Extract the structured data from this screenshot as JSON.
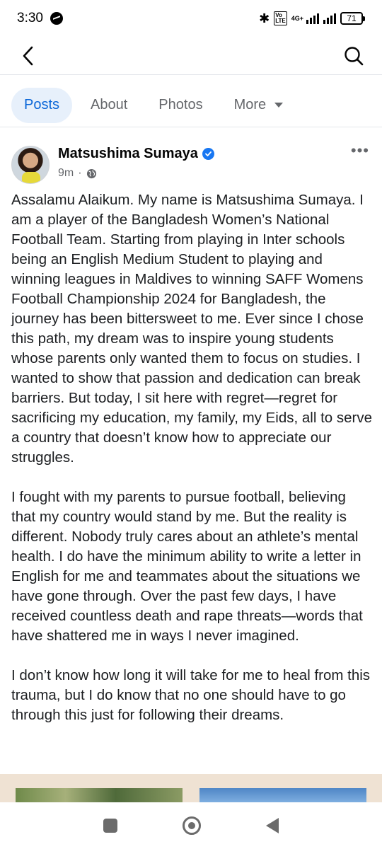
{
  "status_bar": {
    "time": "3:30",
    "network": "4G+",
    "battery": "71"
  },
  "top_bar": {
    "back_icon": "chevron-left-icon",
    "search_icon": "search-icon"
  },
  "tabs": [
    {
      "label": "Posts",
      "active": true
    },
    {
      "label": "About",
      "active": false
    },
    {
      "label": "Photos",
      "active": false
    },
    {
      "label": "More",
      "active": false
    }
  ],
  "post": {
    "author": "Matsushima Sumaya",
    "time": "9m",
    "separator": "·",
    "paragraphs": [
      "Assalamu Alaikum. My name is Matsushima Sumaya. I am a player of the Bangladesh Women’s National Football Team. Starting from playing in Inter schools being an English Medium Student to playing and winning leagues in Maldives to winning SAFF Womens Football Championship 2024 for Bangladesh, the journey has been bittersweet to me. Ever since I chose this path, my dream was to inspire young students whose parents only wanted them to focus on studies. I wanted to show that passion and dedication can break barriers. But today, I sit here with regret—regret for sacrificing my education, my family, my Eids, all to serve a country that doesn’t know how to appreciate our struggles.",
      "I fought with my parents to pursue football, believing that my country would stand by me. But the reality is different. Nobody truly cares about an athlete’s mental health. I do have the minimum ability to write a letter in English for me and teammates about the situations we have gone through. Over the past few days, I have received countless death and rape threats—words that have shattered me in ways I never imagined.",
      "I don’t know how long it will take for me to heal from this trauma, but I do know that no one should have to go through this just for following their dreams."
    ]
  },
  "colors": {
    "accent": "#0a66d8",
    "tab_active_bg": "#e7f0fb",
    "verified": "#1877f2",
    "muted": "#65676b"
  }
}
